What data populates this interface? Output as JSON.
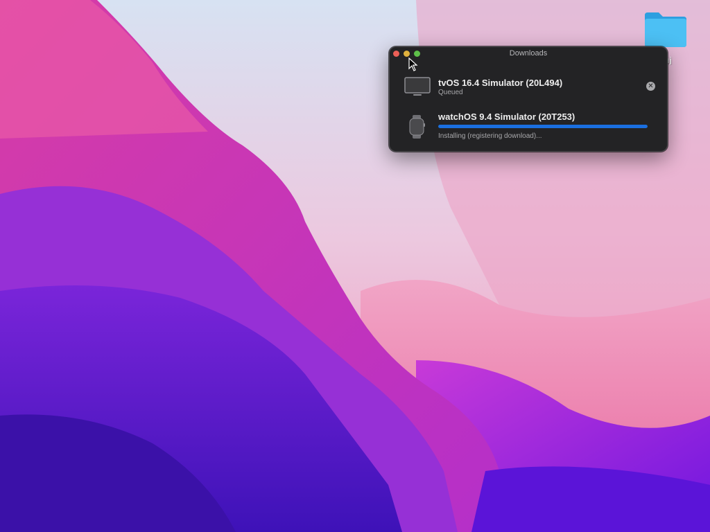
{
  "window": {
    "title": "Downloads"
  },
  "downloads": [
    {
      "name": "tvOS 16.4 Simulator (20L494)",
      "status": "Queued",
      "icon": "tv-icon",
      "cancel_label": "✕"
    },
    {
      "name": "watchOS 9.4 Simulator (20T253)",
      "status": "Installing (registering download)...",
      "icon": "watch-icon",
      "progress": 1.0
    }
  ],
  "desktop": {
    "folder_label": "uj",
    "folder_icon": "folder-icon"
  },
  "colors": {
    "accent": "#1a6fe0",
    "window_bg": "#232325",
    "close": "#ec5f57",
    "minimize": "#e0b23e",
    "zoom": "#5ec04a",
    "folder": "#3fb6f0"
  }
}
